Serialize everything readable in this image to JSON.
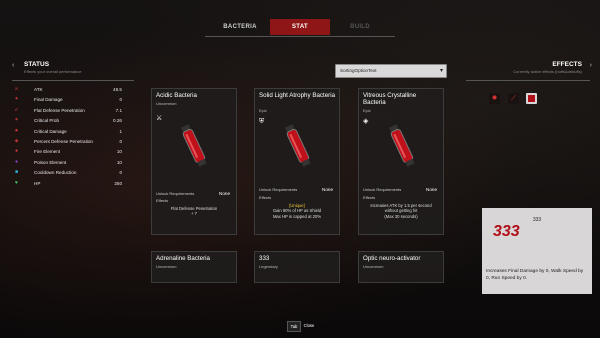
{
  "tabs": [
    {
      "label": "BACTERIA",
      "state": "normal"
    },
    {
      "label": "STAT",
      "state": "active"
    },
    {
      "label": "BUILD",
      "state": "disabled"
    }
  ],
  "status_panel": {
    "title": "STATUS",
    "subtitle": "Effects your overall performance",
    "stats": [
      {
        "icon": "sword-icon",
        "color": "#e03a3a",
        "label": "ATK",
        "value": "48.5"
      },
      {
        "icon": "final-damage-icon",
        "color": "#e03a3a",
        "label": "Final Damage",
        "value": "0"
      },
      {
        "icon": "penetration-icon",
        "color": "#e03a3a",
        "label": "Flat Defense Penetration",
        "value": "7.1"
      },
      {
        "icon": "critical-icon",
        "color": "#e03a3a",
        "label": "Critical Prob",
        "value": "0.26"
      },
      {
        "icon": "critical-damage-icon",
        "color": "#e03a3a",
        "label": "Critical Damage",
        "value": "1"
      },
      {
        "icon": "percent-penetration-icon",
        "color": "#e03a3a",
        "label": "Percent Defense Penetration",
        "value": "0"
      },
      {
        "icon": "fire-icon",
        "color": "#e03a3a",
        "label": "Fire Element",
        "value": "10"
      },
      {
        "icon": "poison-icon",
        "color": "#9b3fd8",
        "label": "Poison Element",
        "value": "10"
      },
      {
        "icon": "cooldown-icon",
        "color": "#2fb9e6",
        "label": "Cooldown Reduction",
        "value": "0"
      },
      {
        "icon": "heart-icon",
        "color": "#3cd46a",
        "label": "HP",
        "value": "250"
      }
    ]
  },
  "sort_dropdown": {
    "value": "SortingOptionText"
  },
  "cards": [
    {
      "name": "Acidic Bacteria",
      "rarity": "Uncommon",
      "unlock_label": "Unlock Requirements",
      "unlock_value": "None",
      "effects_label": "Effects",
      "desc_lines": [
        "Flat Defense Penetration",
        "+ 7"
      ]
    },
    {
      "name": "Solid Light Atrophy Bacteria",
      "rarity": "Epic",
      "unlock_label": "Unlock Requirements",
      "unlock_value": "None",
      "effects_label": "Effects",
      "unique": "[Unique]",
      "desc_lines": [
        "Gain 80% of HP as Shield",
        "Max HP is capped at 20%"
      ]
    },
    {
      "name": "Vitreous Crystalline Bacteria",
      "rarity": "Epic",
      "unlock_label": "Unlock Requirements",
      "unlock_value": "None",
      "effects_label": "Effects",
      "desc_lines": [
        "Increases ATK by 1.5 per second",
        "without getting hit",
        "(Max 30 seconds)"
      ]
    }
  ],
  "bottom_cards": [
    {
      "name": "Adrenaline Bacteria",
      "rarity": "Uncommon"
    },
    {
      "name": "333",
      "rarity": "Legendary"
    },
    {
      "name": "Optic neuro-activator",
      "rarity": "Uncommon"
    }
  ],
  "effects_panel": {
    "title": "EFFECTS",
    "subtitle": "Currently active effects (buffs&debuffs)",
    "icons": [
      "flame-skull-icon",
      "slash-icon",
      "333-badge-icon"
    ]
  },
  "detail": {
    "title": "333",
    "badge": "333",
    "description": "Increases Final Damage by 0, Walk Speed by 0, Run Speed by 0."
  },
  "footer": {
    "tab_key": "Tab",
    "close_label": "Close"
  }
}
